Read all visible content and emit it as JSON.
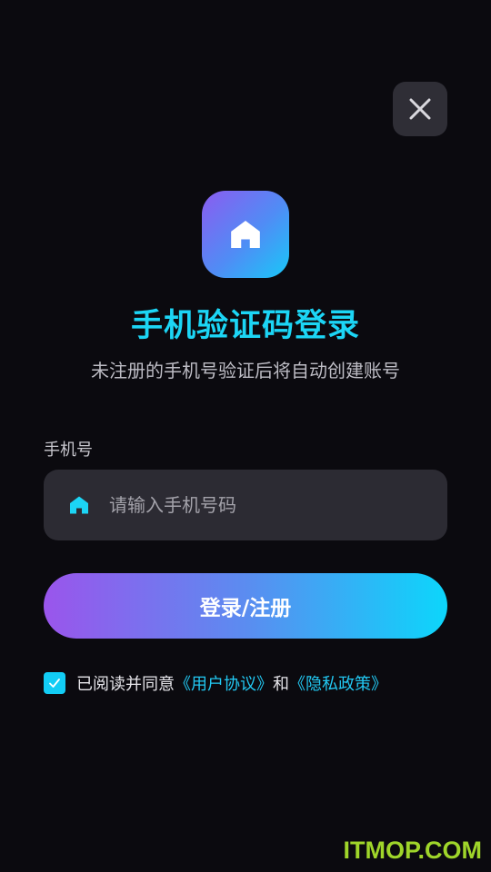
{
  "header": {
    "close_icon": "close-icon"
  },
  "logo": {
    "icon": "home-icon",
    "gradient": [
      "#8b5cf0",
      "#4f8df5",
      "#18c8f8"
    ]
  },
  "title": "手机验证码登录",
  "subtitle": "未注册的手机号验证后将自动创建账号",
  "phone_field": {
    "label": "手机号",
    "icon": "home-icon",
    "placeholder": "请输入手机号码",
    "value": ""
  },
  "login_button": {
    "label": "登录/注册",
    "gradient": [
      "#9a55ec",
      "#5b8cf0",
      "#0cd6fb"
    ]
  },
  "agreement": {
    "checked": true,
    "prefix": "已阅读并同意",
    "user_agreement": "《用户协议》",
    "conjunction": "和",
    "privacy_policy": "《隐私政策》"
  },
  "watermark": "ITMOP.COM",
  "colors": {
    "background": "#0b0a0f",
    "accent": "#1cd5f5",
    "link": "#22c8f2",
    "input_bg": "#2c2b33"
  }
}
